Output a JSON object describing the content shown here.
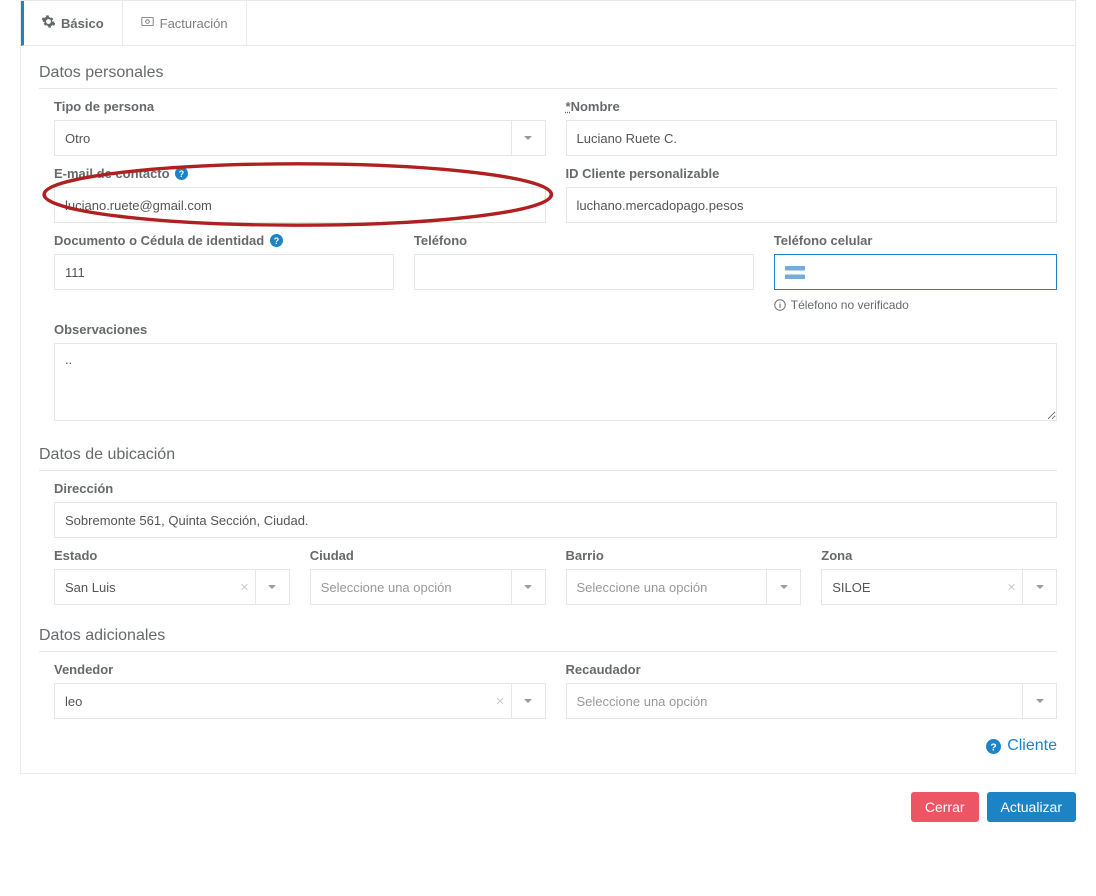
{
  "tabs": {
    "basic": "Básico",
    "billing": "Facturación"
  },
  "sections": {
    "personal": "Datos personales",
    "location": "Datos de ubicación",
    "additional": "Datos adicionales"
  },
  "labels": {
    "person_type": "Tipo de persona",
    "name": "Nombre",
    "email": "E-mail de contacto",
    "client_id": "ID Cliente personalizable",
    "document": "Documento o Cédula de identidad",
    "phone": "Teléfono",
    "cellphone": "Teléfono celular",
    "observations": "Observaciones",
    "address": "Dirección",
    "state": "Estado",
    "city": "Ciudad",
    "neighborhood": "Barrio",
    "zone": "Zona",
    "seller": "Vendedor",
    "collector": "Recaudador"
  },
  "values": {
    "person_type": "Otro",
    "name": "Luciano Ruete C.",
    "email": "luciano.ruete@gmail.com",
    "client_id": "luchano.mercadopago.pesos",
    "document": "111",
    "phone": "",
    "cellphone": "",
    "observations": "..",
    "address": "Sobremonte 561, Quinta Sección, Ciudad.",
    "state": "San Luis",
    "city_placeholder": "Seleccione una opción",
    "neighborhood_placeholder": "Seleccione una opción",
    "zone": "SILOE",
    "seller": "leo",
    "collector_placeholder": "Seleccione una opción"
  },
  "info": {
    "phone_unverified": "Télefono no verificado"
  },
  "links": {
    "client": "Cliente"
  },
  "buttons": {
    "close": "Cerrar",
    "update": "Actualizar"
  }
}
